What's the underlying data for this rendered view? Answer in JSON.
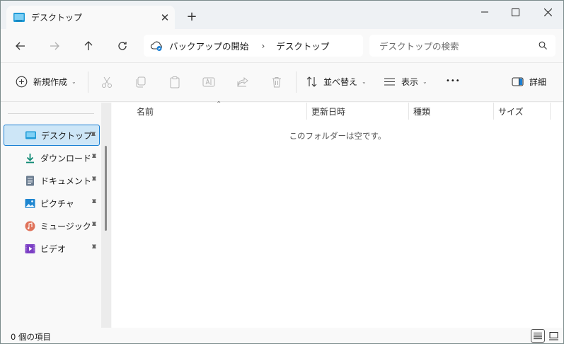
{
  "tab": {
    "title": "デスクトップ",
    "close": "✕",
    "new_tab": "+"
  },
  "window_controls": {
    "minimize": "—",
    "maximize": "☐",
    "close": "✕"
  },
  "address": {
    "root": "バックアップの開始",
    "separator": "›",
    "current": "デスクトップ"
  },
  "search": {
    "placeholder": "デスクトップの検索"
  },
  "commands": {
    "new": "新規作成",
    "sort": "並べ替え",
    "view": "表示",
    "more": "•••",
    "details": "詳細"
  },
  "sidebar": {
    "items": [
      {
        "label": "デスクトップ",
        "icon": "desktop-icon",
        "selected": true
      },
      {
        "label": "ダウンロード",
        "icon": "download-icon",
        "selected": false
      },
      {
        "label": "ドキュメント",
        "icon": "document-icon",
        "selected": false
      },
      {
        "label": "ピクチャ",
        "icon": "pictures-icon",
        "selected": false
      },
      {
        "label": "ミュージック",
        "icon": "music-icon",
        "selected": false
      },
      {
        "label": "ビデオ",
        "icon": "video-icon",
        "selected": false
      }
    ]
  },
  "columns": {
    "name": "名前",
    "modified": "更新日時",
    "type": "種類",
    "size": "サイズ"
  },
  "empty_message": "このフォルダーは空です。",
  "status": {
    "item_count": "0 個の項目"
  },
  "colors": {
    "accent": "#1a7fd4",
    "selection": "#cde6f7"
  }
}
